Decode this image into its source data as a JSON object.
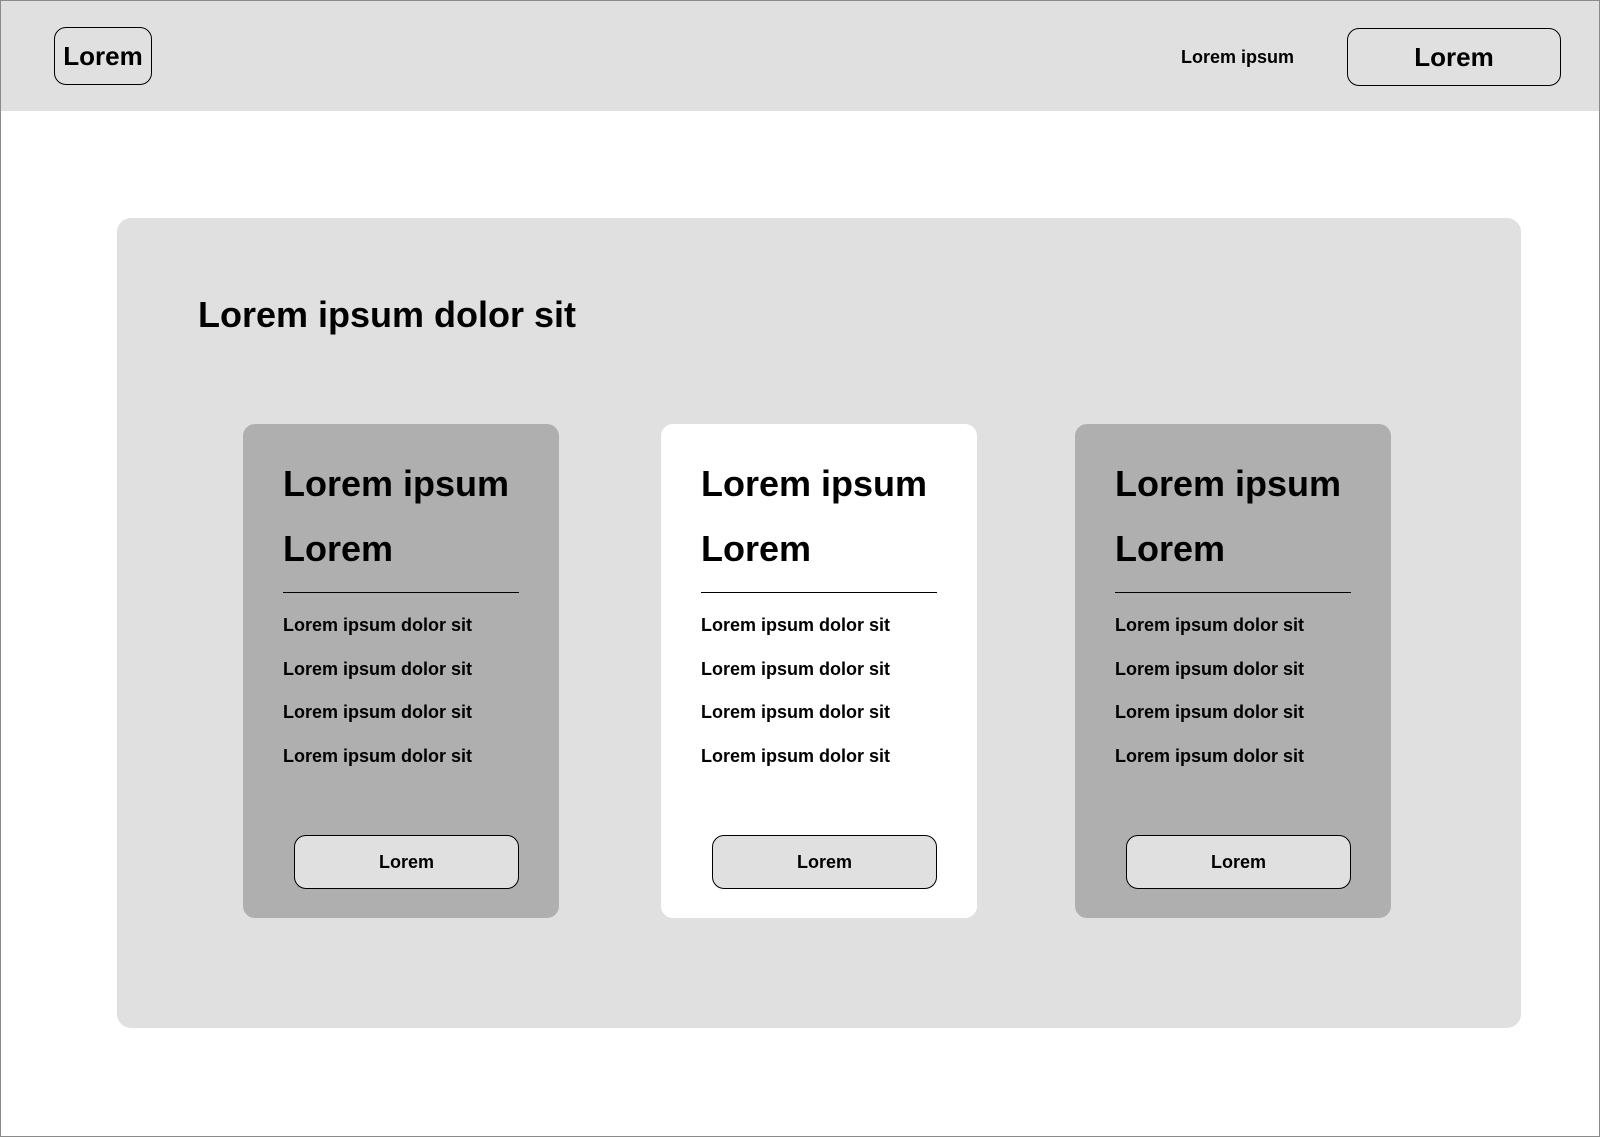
{
  "header": {
    "logo_label": "Lorem",
    "nav_link_label": "Lorem ipsum",
    "cta_label": "Lorem"
  },
  "panel": {
    "title": "Lorem ipsum dolor sit"
  },
  "cards": [
    {
      "title": "Lorem ipsum",
      "subtitle": "Lorem",
      "features": [
        "Lorem ipsum dolor sit",
        "Lorem ipsum dolor sit",
        "Lorem ipsum dolor sit",
        "Lorem ipsum dolor sit"
      ],
      "button_label": "Lorem",
      "background": "#afafaf"
    },
    {
      "title": "Lorem ipsum",
      "subtitle": "Lorem",
      "features": [
        "Lorem ipsum dolor sit",
        "Lorem ipsum dolor sit",
        "Lorem ipsum dolor sit",
        "Lorem ipsum dolor sit"
      ],
      "button_label": "Lorem",
      "background": "#ffffff"
    },
    {
      "title": "Lorem ipsum",
      "subtitle": "Lorem",
      "features": [
        "Lorem ipsum dolor sit",
        "Lorem ipsum dolor sit",
        "Lorem ipsum dolor sit",
        "Lorem ipsum dolor sit"
      ],
      "button_label": "Lorem",
      "background": "#afafaf"
    }
  ],
  "colors": {
    "header_bg": "#e0e0e0",
    "panel_bg": "#e0e0e0",
    "card_grey": "#afafaf",
    "card_highlight": "#ffffff",
    "border": "#000000"
  }
}
